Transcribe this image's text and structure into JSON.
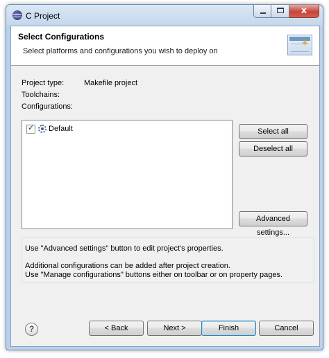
{
  "window": {
    "title": "C Project",
    "minimize_glyph": "",
    "close_glyph": "x"
  },
  "banner": {
    "title": "Select Configurations",
    "description": "Select platforms and configurations you wish to deploy on",
    "icon": "wizard-banner-icon",
    "sparkle": "✦"
  },
  "fields": {
    "project_type_label": "Project type:",
    "project_type_value": "Makefile project",
    "toolchains_label": "Toolchains:",
    "configurations_label": "Configurations:"
  },
  "config_list": {
    "items": [
      {
        "label": "Default",
        "checked": true,
        "check_glyph": "✓",
        "icon": "gear-icon"
      }
    ]
  },
  "side_buttons": {
    "select_all": "Select all",
    "deselect_all": "Deselect all",
    "advanced_settings": "Advanced settings..."
  },
  "info": {
    "line1": "Use \"Advanced settings\" button to edit project's properties.",
    "line2": "Additional configurations can be added after project creation.",
    "line3": "Use \"Manage configurations\" buttons either on toolbar or on property pages."
  },
  "footer": {
    "help_glyph": "?",
    "back": "< Back",
    "next": "Next >",
    "finish": "Finish",
    "cancel": "Cancel"
  }
}
